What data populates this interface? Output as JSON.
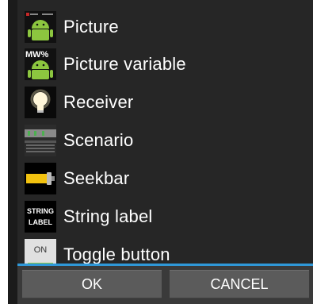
{
  "items": [
    {
      "label": "Picture",
      "icon": "android-icon"
    },
    {
      "label": "Picture  variable",
      "icon": "android-variable-icon",
      "icon_text": "MW%"
    },
    {
      "label": "Receiver",
      "icon": "lightbulb-icon"
    },
    {
      "label": "Scenario",
      "icon": "scenario-icon"
    },
    {
      "label": "Seekbar",
      "icon": "seekbar-icon"
    },
    {
      "label": "String label",
      "icon": "string-label-icon",
      "icon_text_1": "STRING",
      "icon_text_2": "LABEL"
    },
    {
      "label": "Toggle button",
      "icon": "toggle-on-icon",
      "icon_text": "ON"
    }
  ],
  "buttons": {
    "ok": "OK",
    "cancel": "CANCEL"
  },
  "colors": {
    "accent": "#2f98d8",
    "list_bg": "#262626",
    "button_bg": "#5b5b5b",
    "android_green": "#8cc63f",
    "seekbar_yellow": "#f2c20f"
  }
}
